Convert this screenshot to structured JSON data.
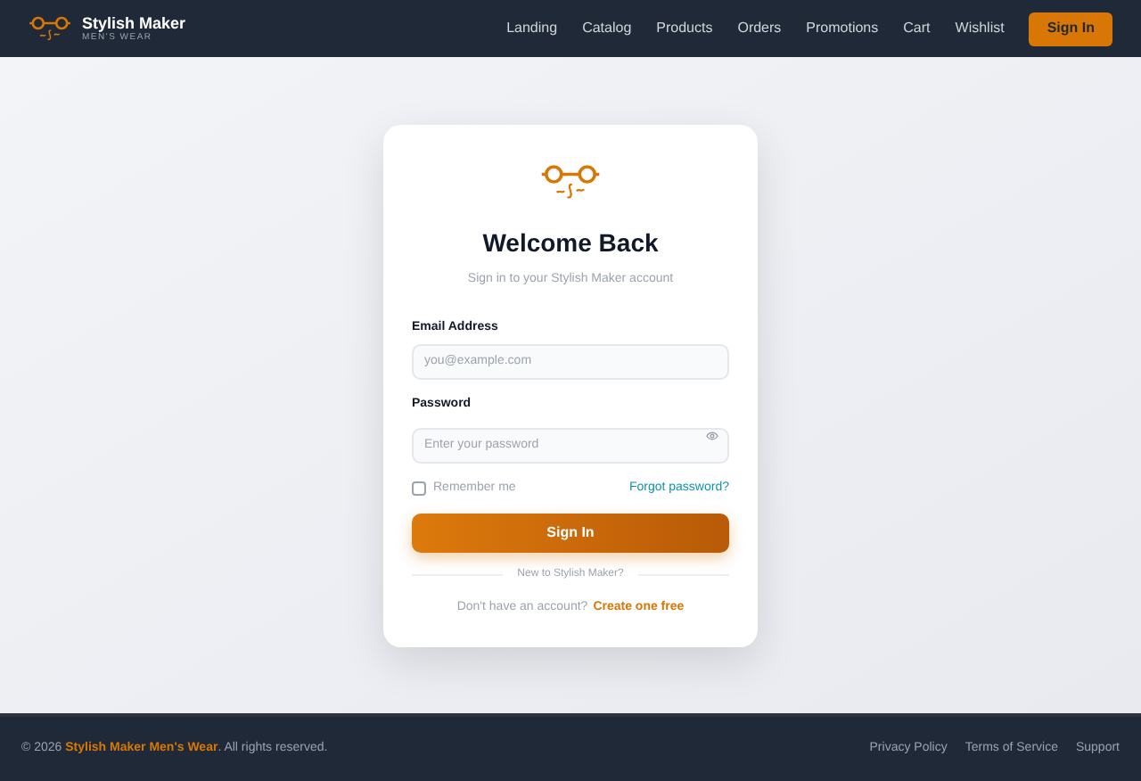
{
  "header": {
    "brand": "Stylish Maker",
    "tagline": "MEN'S WEAR",
    "nav": [
      {
        "label": "Landing"
      },
      {
        "label": "Catalog"
      },
      {
        "label": "Products"
      },
      {
        "label": "Orders"
      },
      {
        "label": "Promotions"
      },
      {
        "label": "Cart"
      },
      {
        "label": "Wishlist"
      }
    ],
    "button": "Sign In"
  },
  "card": {
    "title": "Welcome Back",
    "subtitle": "Sign in to your Stylish Maker account",
    "email": {
      "label": "Email Address",
      "placeholder": "you@example.com"
    },
    "password": {
      "label": "Password",
      "placeholder": "Enter your password"
    },
    "remember": {
      "label": "Remember me",
      "checked": false
    },
    "forgot": "Forgot password?",
    "submit": "Sign In",
    "divider": "New to Stylish Maker?",
    "signup_prompt": "Don't have an account?",
    "signup_link": "Create one free"
  },
  "footer": {
    "copyright": "© 2026 **Stylish Maker Men's Wear**. All rights reserved.",
    "links": [
      "Privacy Policy",
      "Terms of Service",
      "Support"
    ]
  }
}
